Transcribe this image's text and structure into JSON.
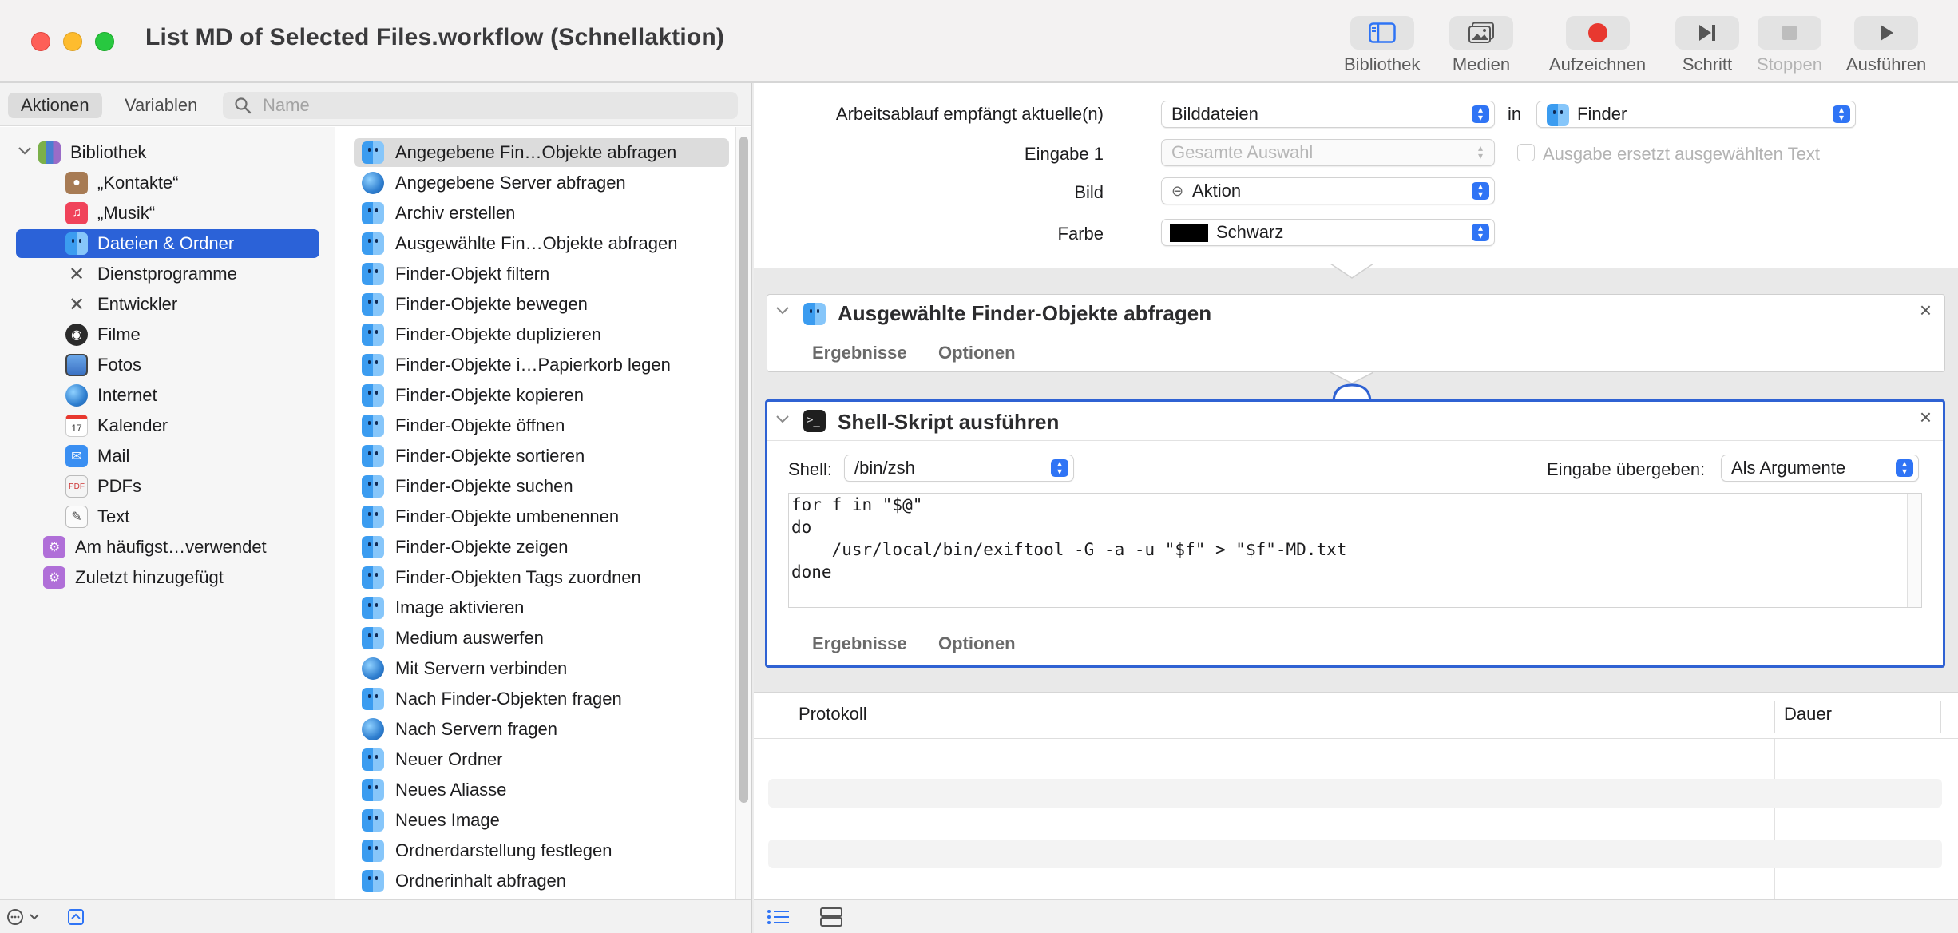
{
  "window": {
    "title": "List MD of Selected Files.workflow (Schnellaktion)"
  },
  "toolbar": {
    "library_label": "Bibliothek",
    "media_label": "Medien",
    "record_label": "Aufzeichnen",
    "step_label": "Schritt",
    "stop_label": "Stoppen",
    "run_label": "Ausführen"
  },
  "library_panel": {
    "tabs": [
      {
        "label": "Aktionen",
        "active": true
      },
      {
        "label": "Variablen",
        "active": false
      }
    ],
    "search_placeholder": "Name",
    "tree": {
      "root": "Bibliothek",
      "items": [
        {
          "label": "„Kontakte“",
          "icon": "contacts-icon"
        },
        {
          "label": "„Musik“",
          "icon": "music-icon"
        },
        {
          "label": "Dateien & Ordner",
          "icon": "finder-icon",
          "selected": true
        },
        {
          "label": "Dienstprogramme",
          "icon": "utilities-icon"
        },
        {
          "label": "Entwickler",
          "icon": "developer-icon"
        },
        {
          "label": "Filme",
          "icon": "movies-icon"
        },
        {
          "label": "Fotos",
          "icon": "photos-icon"
        },
        {
          "label": "Internet",
          "icon": "internet-icon"
        },
        {
          "label": "Kalender",
          "icon": "calendar-icon"
        },
        {
          "label": "Mail",
          "icon": "mail-icon"
        },
        {
          "label": "PDFs",
          "icon": "pdf-icon"
        },
        {
          "label": "Text",
          "icon": "text-icon"
        }
      ],
      "smart_groups": [
        {
          "label": "Am häufigst…verwendet",
          "icon": "smart-folder-icon"
        },
        {
          "label": "Zuletzt hinzugefügt",
          "icon": "smart-folder-icon"
        }
      ]
    },
    "actions": [
      {
        "label": "Angegebene Fin…Objekte abfragen",
        "icon": "finder",
        "selected": true
      },
      {
        "label": "Angegebene Server abfragen",
        "icon": "globe"
      },
      {
        "label": "Archiv erstellen",
        "icon": "finder"
      },
      {
        "label": "Ausgewählte Fin…Objekte abfragen",
        "icon": "finder"
      },
      {
        "label": "Finder-Objekt filtern",
        "icon": "finder"
      },
      {
        "label": "Finder-Objekte bewegen",
        "icon": "finder"
      },
      {
        "label": "Finder-Objekte duplizieren",
        "icon": "finder"
      },
      {
        "label": "Finder-Objekte i…Papierkorb legen",
        "icon": "finder"
      },
      {
        "label": "Finder-Objekte kopieren",
        "icon": "finder"
      },
      {
        "label": "Finder-Objekte öffnen",
        "icon": "finder"
      },
      {
        "label": "Finder-Objekte sortieren",
        "icon": "finder"
      },
      {
        "label": "Finder-Objekte suchen",
        "icon": "finder"
      },
      {
        "label": "Finder-Objekte umbenennen",
        "icon": "finder"
      },
      {
        "label": "Finder-Objekte zeigen",
        "icon": "finder"
      },
      {
        "label": "Finder-Objekten Tags zuordnen",
        "icon": "finder"
      },
      {
        "label": "Image aktivieren",
        "icon": "finder"
      },
      {
        "label": "Medium auswerfen",
        "icon": "finder"
      },
      {
        "label": "Mit Servern verbinden",
        "icon": "globe"
      },
      {
        "label": "Nach Finder-Objekten fragen",
        "icon": "finder"
      },
      {
        "label": "Nach Servern fragen",
        "icon": "globe"
      },
      {
        "label": "Neuer Ordner",
        "icon": "finder"
      },
      {
        "label": "Neues Aliasse",
        "icon": "finder"
      },
      {
        "label": "Neues Image",
        "icon": "finder"
      },
      {
        "label": "Ordnerdarstellung festlegen",
        "icon": "finder"
      },
      {
        "label": "Ordnerinhalt abfragen",
        "icon": "finder"
      }
    ]
  },
  "workflow_header": {
    "receives_label": "Arbeitsablauf empfängt aktuelle(n)",
    "receives_value": "Bilddateien",
    "in_label": "in",
    "in_value": "Finder",
    "input_label": "Eingabe 1",
    "input_value": "Gesamte Auswahl",
    "replaces_label": "Ausgabe ersetzt ausgewählten Text",
    "image_label": "Bild",
    "image_value": "Aktion",
    "color_label": "Farbe",
    "color_value": "Schwarz",
    "color_swatch": "#000000"
  },
  "actions_in_workflow": [
    {
      "title": "Ausgewählte Finder-Objekte abfragen",
      "tabs": [
        "Ergebnisse",
        "Optionen"
      ]
    },
    {
      "title": "Shell-Skript ausführen",
      "shell_label": "Shell:",
      "shell_value": "/bin/zsh",
      "pass_input_label": "Eingabe übergeben:",
      "pass_input_value": "Als Argumente",
      "script_lines": [
        "for f in \"$@\"",
        "do",
        "    /usr/local/bin/exiftool -G -a -u \"$f\" > \"$f\"-MD.txt",
        "done"
      ],
      "tabs": [
        "Ergebnisse",
        "Optionen"
      ]
    }
  ],
  "log": {
    "columns": [
      "Protokoll",
      "Dauer"
    ]
  },
  "colors": {
    "accent": "#2f74f5",
    "selection": "#2b62d8",
    "record": "#e8382f"
  }
}
